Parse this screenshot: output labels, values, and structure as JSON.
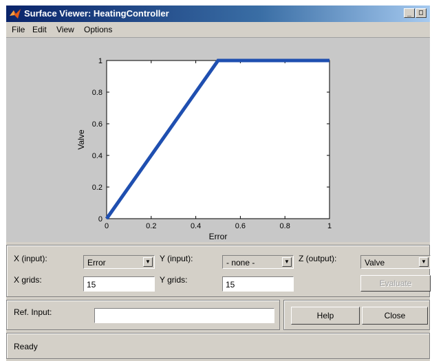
{
  "window": {
    "title": "Surface Viewer: HeatingController"
  },
  "menu": {
    "items": [
      "File",
      "Edit",
      "View",
      "Options"
    ]
  },
  "chart_data": {
    "type": "line",
    "series": [
      {
        "x": [
          0,
          0.5,
          1
        ],
        "y": [
          0,
          1,
          1
        ]
      }
    ],
    "xlabel": "Error",
    "ylabel": "Valve",
    "xlim": [
      0,
      1
    ],
    "ylim": [
      0,
      1
    ],
    "xticks": [
      "0",
      "0.2",
      "0.4",
      "0.6",
      "0.8",
      "1"
    ],
    "yticks": [
      "0",
      "0.2",
      "0.4",
      "0.6",
      "0.8",
      "1"
    ],
    "line_color": "#1f4fb0",
    "grid": false
  },
  "controls": {
    "x_input_label": "X (input):",
    "x_input_value": "Error",
    "y_input_label": "Y (input):",
    "y_input_value": "- none -",
    "z_output_label": "Z (output):",
    "z_output_value": "Valve",
    "x_grids_label": "X grids:",
    "x_grids_value": "15",
    "y_grids_label": "Y grids:",
    "y_grids_value": "15",
    "evaluate_label": "Evaluate"
  },
  "ref": {
    "label": "Ref. Input:",
    "value": ""
  },
  "buttons": {
    "help": "Help",
    "close": "Close"
  },
  "status": {
    "text": "Ready"
  }
}
